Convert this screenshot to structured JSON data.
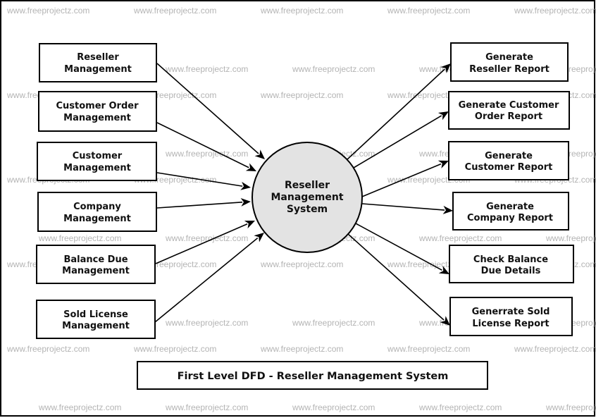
{
  "diagram": {
    "type": "Data Flow Diagram",
    "level": "First Level",
    "title": "First Level DFD - Reseller Management System",
    "colors": {
      "process_fill": "#e3e3e3",
      "stroke": "#000000",
      "watermark": "#b4b4b4"
    },
    "watermark_text": "www.freeprojectz.com",
    "central_process": {
      "lines": [
        "Reseller",
        "Management",
        "System"
      ]
    },
    "inputs": [
      {
        "id": "reseller-management",
        "lines": [
          "Reseller",
          "Management"
        ]
      },
      {
        "id": "customer-order-management",
        "lines": [
          "Customer Order",
          "Management"
        ]
      },
      {
        "id": "customer-management",
        "lines": [
          "Customer",
          "Management"
        ]
      },
      {
        "id": "company-management",
        "lines": [
          "Company",
          "Management"
        ]
      },
      {
        "id": "balance-due-management",
        "lines": [
          "Balance Due",
          "Management"
        ]
      },
      {
        "id": "sold-license-management",
        "lines": [
          "Sold License",
          "Management"
        ]
      }
    ],
    "outputs": [
      {
        "id": "generate-reseller-report",
        "lines": [
          "Generate",
          "Reseller Report"
        ]
      },
      {
        "id": "generate-customer-order-report",
        "lines": [
          "Generate Customer",
          "Order Report"
        ]
      },
      {
        "id": "generate-customer-report",
        "lines": [
          "Generate",
          "Customer Report"
        ]
      },
      {
        "id": "generate-company-report",
        "lines": [
          "Generate",
          "Company Report"
        ]
      },
      {
        "id": "check-balance-due-details",
        "lines": [
          "Check Balance",
          "Due Details"
        ]
      },
      {
        "id": "generrate-sold-license-report",
        "lines": [
          "Generrate Sold",
          "License Report"
        ]
      }
    ]
  }
}
